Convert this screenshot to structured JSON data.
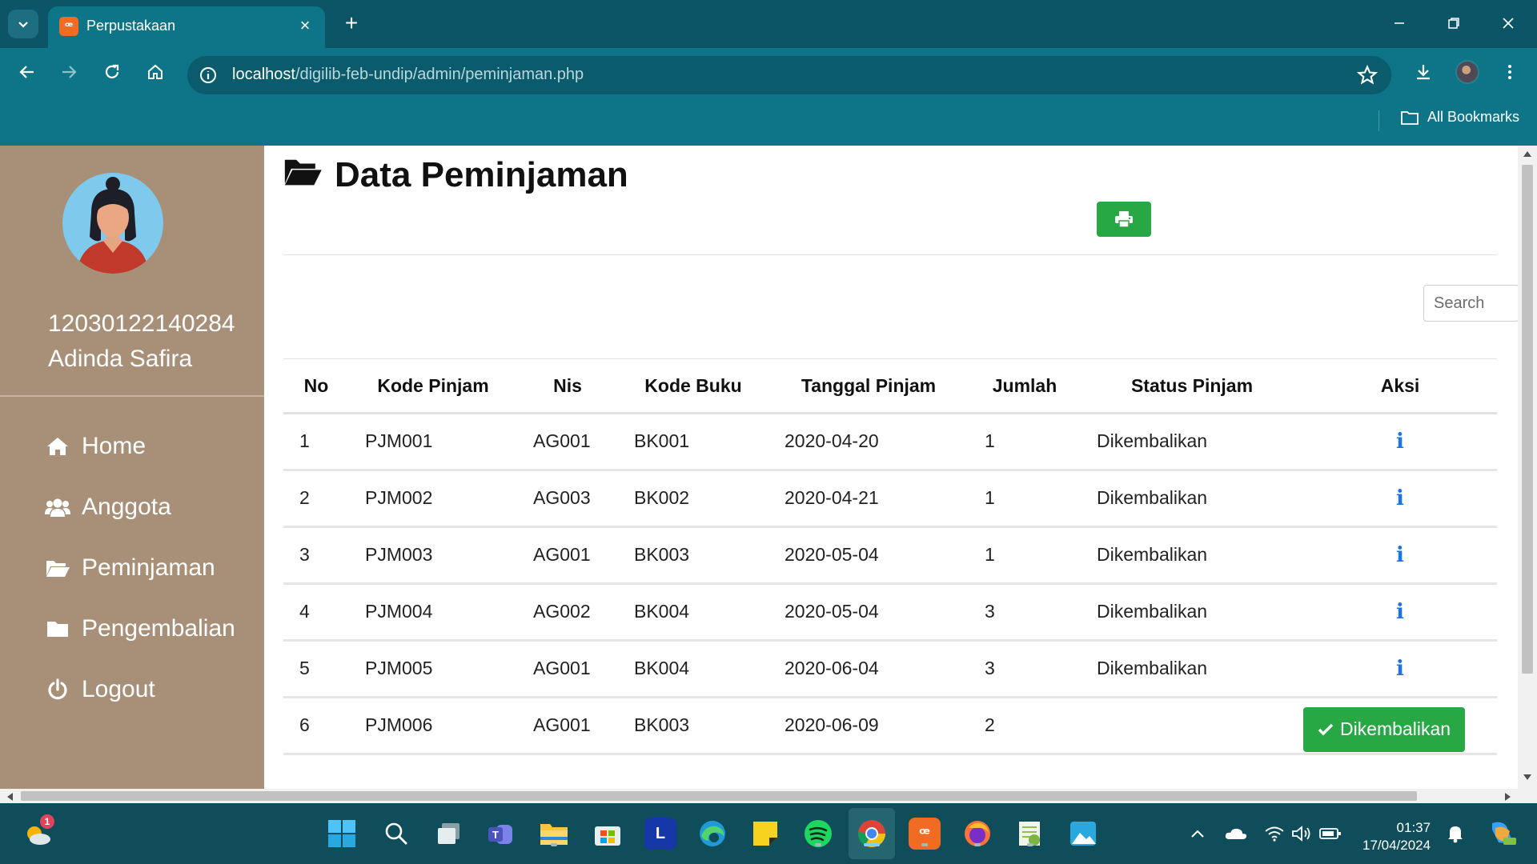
{
  "browser": {
    "tab_title": "Perpustakaan",
    "url_host": "localhost",
    "url_path": "/digilib-feb-undip/admin/peminjaman.php",
    "bookmarks_label": "All Bookmarks"
  },
  "sidebar": {
    "user_id": "12030122140284",
    "user_name": "Adinda Safira",
    "items": [
      {
        "label": "Home",
        "icon": "home-icon"
      },
      {
        "label": "Anggota",
        "icon": "users-icon"
      },
      {
        "label": "Peminjaman",
        "icon": "folder-open-icon"
      },
      {
        "label": "Pengembalian",
        "icon": "folder-icon"
      },
      {
        "label": "Logout",
        "icon": "power-icon"
      }
    ]
  },
  "main": {
    "title": "Data Peminjaman",
    "search_placeholder": "Search",
    "columns": [
      "No",
      "Kode Pinjam",
      "Nis",
      "Kode Buku",
      "Tanggal Pinjam",
      "Jumlah",
      "Status Pinjam",
      "Aksi"
    ],
    "rows": [
      {
        "no": "1",
        "kode": "PJM001",
        "nis": "AG001",
        "buku": "BK001",
        "tanggal": "2020-04-20",
        "jumlah": "1",
        "status": "Dikembalikan"
      },
      {
        "no": "2",
        "kode": "PJM002",
        "nis": "AG003",
        "buku": "BK002",
        "tanggal": "2020-04-21",
        "jumlah": "1",
        "status": "Dikembalikan"
      },
      {
        "no": "3",
        "kode": "PJM003",
        "nis": "AG001",
        "buku": "BK003",
        "tanggal": "2020-05-04",
        "jumlah": "1",
        "status": "Dikembalikan"
      },
      {
        "no": "4",
        "kode": "PJM004",
        "nis": "AG002",
        "buku": "BK004",
        "tanggal": "2020-05-04",
        "jumlah": "3",
        "status": "Dikembalikan"
      },
      {
        "no": "5",
        "kode": "PJM005",
        "nis": "AG001",
        "buku": "BK004",
        "tanggal": "2020-06-04",
        "jumlah": "3",
        "status": "Dikembalikan"
      },
      {
        "no": "6",
        "kode": "PJM006",
        "nis": "AG001",
        "buku": "BK003",
        "tanggal": "2020-06-09",
        "jumlah": "2",
        "status": ""
      }
    ],
    "return_button_label": "Dikembalikan"
  },
  "taskbar": {
    "weather_badge": "1",
    "time": "01:37",
    "date": "17/04/2024"
  },
  "colors": {
    "chrome_dark": "#0b5566",
    "chrome": "#0e7487",
    "sidebar": "#a89078",
    "success": "#28a745",
    "info": "#1a73e8"
  }
}
